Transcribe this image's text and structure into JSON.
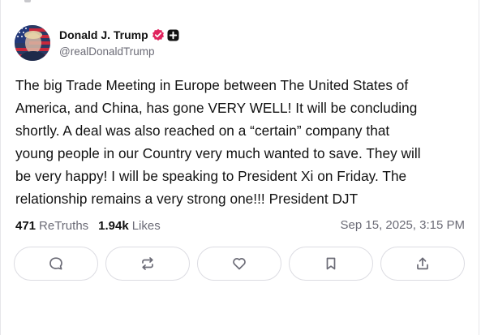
{
  "post": {
    "author": {
      "display_name": "Donald J. Trump",
      "handle": "@realDonaldTrump",
      "verified_icon": "verified-badge-icon",
      "badge_icon": "plus-badge-icon"
    },
    "text_lines": [
      "The big Trade Meeting in Europe between The United States of",
      "America, and China,  has gone VERY WELL! It will be concluding",
      "shortly. A deal was also reached on a “certain” company that",
      "young people in our Country very much wanted to save. They will",
      "be very happy! I will be speaking to President Xi on Friday. The",
      "relationship remains a very strong one!!! President DJT"
    ],
    "stats": {
      "retruths_count": "471",
      "retruths_label": "ReTruths",
      "likes_count": "1.94k",
      "likes_label": "Likes"
    },
    "timestamp": "Sep 15, 2025, 3:15 PM",
    "actions": [
      {
        "icon": "reply-icon"
      },
      {
        "icon": "retruth-icon"
      },
      {
        "icon": "like-icon"
      },
      {
        "icon": "bookmark-icon"
      },
      {
        "icon": "share-icon"
      }
    ]
  },
  "colors": {
    "verified": "#e0245e",
    "muted_text": "#6b6b76",
    "border": "#dcdce2",
    "icon": "#6b6b76"
  }
}
